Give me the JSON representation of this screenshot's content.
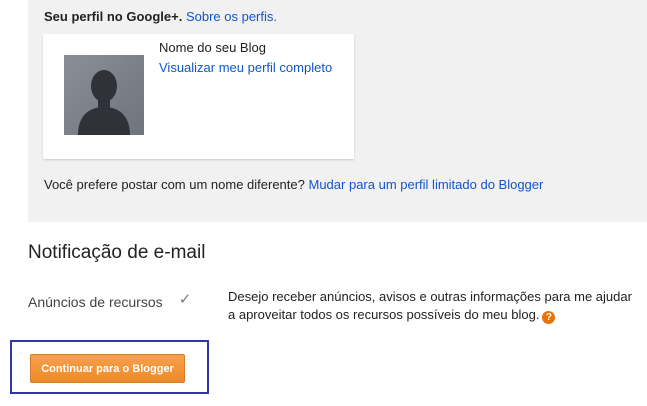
{
  "profile": {
    "heading": "Seu perfil no Google+.",
    "about_link": "Sobre os perfis.",
    "blog_name": "Nome do seu Blog",
    "view_profile_link": "Visualizar meu perfil completo",
    "alt_name_text": "Você prefere postar com um nome diferente?",
    "alt_name_link": "Mudar para um perfil limitado do Blogger"
  },
  "notifications": {
    "title": "Notificação de e-mail",
    "feature_label": "Anúncios de recursos",
    "checkbox_checked": true,
    "description": "Desejo receber anúncios, avisos e outras informações para me ajudar a aproveitar todos os recursos possíveis do meu blog.",
    "help_icon": "question-circle-icon"
  },
  "actions": {
    "continue_label": "Continuar para o Blogger"
  },
  "colors": {
    "link": "#1155cc",
    "button": "#f39a43",
    "panel": "#f1f1f1",
    "highlight": "#3333aa"
  }
}
